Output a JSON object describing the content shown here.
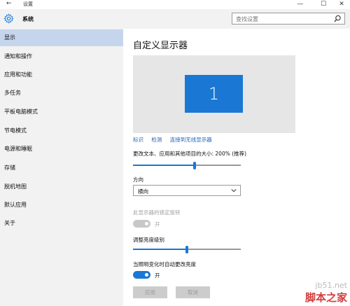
{
  "window": {
    "back_glyph": "←",
    "title": "设置",
    "min_glyph": "—",
    "max_glyph": "☐",
    "close_glyph": "✕"
  },
  "header": {
    "icon": "gear-icon",
    "section": "系统",
    "search_placeholder": "查找设置",
    "search_icon": "search-icon"
  },
  "sidebar": {
    "items": [
      {
        "label": "显示",
        "active": true
      },
      {
        "label": "通知和操作",
        "active": false
      },
      {
        "label": "应用和功能",
        "active": false
      },
      {
        "label": "多任务",
        "active": false
      },
      {
        "label": "平板电脑模式",
        "active": false
      },
      {
        "label": "节电模式",
        "active": false
      },
      {
        "label": "电源和睡眠",
        "active": false
      },
      {
        "label": "存储",
        "active": false
      },
      {
        "label": "脱机地图",
        "active": false
      },
      {
        "label": "默认应用",
        "active": false
      },
      {
        "label": "关于",
        "active": false
      }
    ]
  },
  "main": {
    "title": "自定义显示器",
    "monitor_number": "1",
    "links": {
      "identify": "标识",
      "detect": "检测",
      "wireless": "连接到无线显示器"
    },
    "scale_label": "更改文本、应用和其他项目的大小: 200% (推荐)",
    "scale_slider_value": 0.57,
    "orientation_label": "方向",
    "orientation_value": "横向",
    "rotation_lock_label": "此显示器的锁定旋转",
    "rotation_lock_state": "开",
    "brightness_label": "调整亮度级别",
    "brightness_slider_value": 0.5,
    "auto_brightness_label": "当照明变化时自动更改亮度",
    "auto_brightness_state": "开",
    "apply_button": "应用",
    "cancel_button": "取消"
  },
  "colors": {
    "accent": "#1a78d4",
    "sidebar_bg": "#f2f2f2",
    "active_item": "#c5d5ec"
  },
  "watermark": {
    "site": "jb51.net",
    "brand": "脚本之家"
  }
}
